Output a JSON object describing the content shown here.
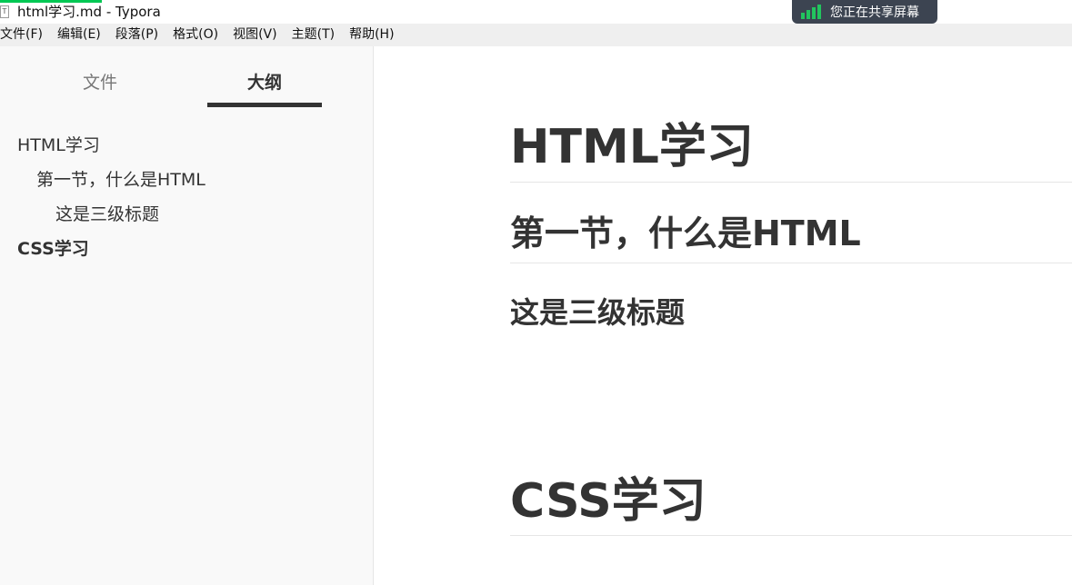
{
  "window": {
    "title": "html学习.md - Typora",
    "app_icon_glyph": "T"
  },
  "share_badge": {
    "label": "您正在共享屏幕",
    "color": "#22c55e"
  },
  "menu": {
    "items": [
      "文件(F)",
      "编辑(E)",
      "段落(P)",
      "格式(O)",
      "视图(V)",
      "主题(T)",
      "帮助(H)"
    ]
  },
  "sidebar": {
    "tabs": {
      "files": "文件",
      "outline": "大纲",
      "active": "outline"
    },
    "outline": [
      {
        "text": "HTML学习",
        "level": 1,
        "active": false
      },
      {
        "text": "第一节，什么是HTML",
        "level": 2,
        "active": false
      },
      {
        "text": "这是三级标题",
        "level": 3,
        "active": false
      },
      {
        "text": "CSS学习",
        "level": 1,
        "active": true
      }
    ]
  },
  "document": {
    "h1_html": "HTML学习",
    "h2_what_is_html": "第一节，什么是HTML",
    "h3_third_level": "这是三级标题",
    "h1_css": "CSS学习"
  }
}
